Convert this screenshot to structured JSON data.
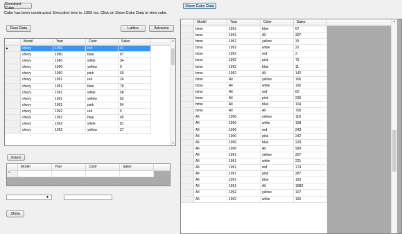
{
  "toolbar": {
    "construct_label": "Construct Cube",
    "show_cube_label": "Show Cube Data",
    "status_text": "Cube has been constructed. Execution time is: 1950 ms. Click on Show Cube Data to view cube.",
    "raw_data_label": "Raw Data",
    "lattice_label": "Lattice",
    "advance_label": "Advance"
  },
  "left_grid": {
    "columns": [
      "Model",
      "Year",
      "Color",
      "Sales"
    ],
    "rows": [
      [
        "chevy",
        "1990",
        "red",
        "41"
      ],
      [
        "chevy",
        "1990",
        "blue",
        "67"
      ],
      [
        "chevy",
        "1990",
        "white",
        "34"
      ],
      [
        "chevy",
        "1990",
        "yellow",
        "0"
      ],
      [
        "chevy",
        "1990",
        "pink",
        "69"
      ],
      [
        "chevy",
        "1991",
        "red",
        "24"
      ],
      [
        "chevy",
        "1991",
        "blue",
        "78"
      ],
      [
        "chevy",
        "1991",
        "white",
        "58"
      ],
      [
        "chevy",
        "1991",
        "yellow",
        "62"
      ],
      [
        "chevy",
        "1991",
        "pink",
        "64"
      ],
      [
        "chevy",
        "1992",
        "red",
        "5"
      ],
      [
        "chevy",
        "1992",
        "blue",
        "45"
      ],
      [
        "chevy",
        "1992",
        "white",
        "81"
      ],
      [
        "chevy",
        "1992",
        "yellow",
        "27"
      ]
    ],
    "selected_row": 0
  },
  "insert": {
    "button_label": "Insert",
    "columns": [
      "Model",
      "Year",
      "Color",
      "Sales"
    ],
    "new_row_marker": "*"
  },
  "filters": {
    "combo_value": "",
    "text_value": "",
    "show_label": "Show"
  },
  "cube_grid": {
    "columns": [
      "Model",
      "Year",
      "Color",
      "Sales"
    ],
    "rows": [
      [
        "bmw",
        "1991",
        "blue",
        "67"
      ],
      [
        "bmw",
        "1991",
        "All",
        "307"
      ],
      [
        "bmw",
        "1992",
        "yellow",
        "33"
      ],
      [
        "bmw",
        "1992",
        "white",
        "22"
      ],
      [
        "bmw",
        "1992",
        "red",
        "3"
      ],
      [
        "bmw",
        "1992",
        "pink",
        "73"
      ],
      [
        "bmw",
        "1992",
        "blue",
        "11"
      ],
      [
        "bmw",
        "1992",
        "All",
        "142"
      ],
      [
        "bmw",
        "All",
        "yellow",
        "106"
      ],
      [
        "bmw",
        "All",
        "white",
        "192"
      ],
      [
        "bmw",
        "All",
        "red",
        "62"
      ],
      [
        "bmw",
        "All",
        "pink",
        "236"
      ],
      [
        "bmw",
        "All",
        "blue",
        "104"
      ],
      [
        "bmw",
        "All",
        "All",
        "700"
      ],
      [
        "All",
        "1990",
        "yellow",
        "118"
      ],
      [
        "All",
        "1990",
        "white",
        "158"
      ],
      [
        "All",
        "1990",
        "red",
        "243"
      ],
      [
        "All",
        "1990",
        "pink",
        "242"
      ],
      [
        "All",
        "1990",
        "blue",
        "229"
      ],
      [
        "All",
        "1990",
        "All",
        "990"
      ],
      [
        "All",
        "1991",
        "yellow",
        "207"
      ],
      [
        "All",
        "1991",
        "white",
        "221"
      ],
      [
        "All",
        "1991",
        "red",
        "174"
      ],
      [
        "All",
        "1991",
        "pink",
        "287"
      ],
      [
        "All",
        "1991",
        "blue",
        "193"
      ],
      [
        "All",
        "1991",
        "All",
        "1082"
      ],
      [
        "All",
        "1992",
        "yellow",
        "107"
      ],
      [
        "All",
        "1992",
        "white",
        "160"
      ]
    ]
  }
}
